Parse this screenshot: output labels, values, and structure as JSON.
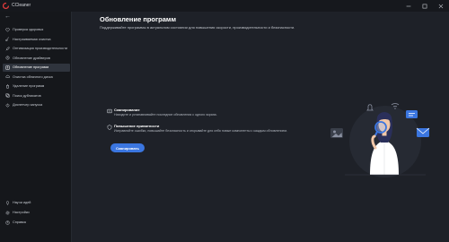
{
  "app": {
    "name": "CCleaner"
  },
  "sidebar": {
    "items": [
      {
        "label": "Проверка здоровья",
        "icon": "heart-icon",
        "active": false
      },
      {
        "label": "Настраиваемая очистка",
        "icon": "brush-icon",
        "active": false
      },
      {
        "label": "Оптимизация производительности",
        "icon": "rocket-icon",
        "active": false
      },
      {
        "label": "Обновление драйверов",
        "icon": "driver-icon",
        "active": false
      },
      {
        "label": "Обновление программ",
        "icon": "update-icon",
        "active": true
      },
      {
        "label": "Очистка облачного диска",
        "icon": "cloud-icon",
        "active": false
      },
      {
        "label": "Удаление программ",
        "icon": "uninstall-icon",
        "active": false
      },
      {
        "label": "Поиск дубликатов",
        "icon": "duplicate-icon",
        "active": false
      },
      {
        "label": "Диспетчер запуска",
        "icon": "startup-icon",
        "active": false
      }
    ],
    "bottom_items": [
      {
        "label": "Научи идей",
        "icon": "lightbulb-icon"
      },
      {
        "label": "Настройки",
        "icon": "gear-icon"
      },
      {
        "label": "Справка",
        "icon": "help-icon"
      }
    ]
  },
  "main": {
    "title": "Обновление программ",
    "description": "Поддерживайте программы в актуальном состоянии для повышения скорости, производительности и безопасности.",
    "features": [
      {
        "title": "Сканирование",
        "description": "Находите и устанавливайте последние обновления с одного экрана.",
        "icon": "scan-icon"
      },
      {
        "title": "Повышение приватности",
        "description": "Исправляйте ошибки, повышайте безопасность и открывайте для себя новые компоненты с каждым обновлением.",
        "icon": "shield-icon"
      }
    ],
    "scan_button": "Сканировать"
  },
  "colors": {
    "background": "#1e2128",
    "sidebar": "#15171b",
    "active_item": "#2f343d",
    "accent": "#3b76e0"
  }
}
